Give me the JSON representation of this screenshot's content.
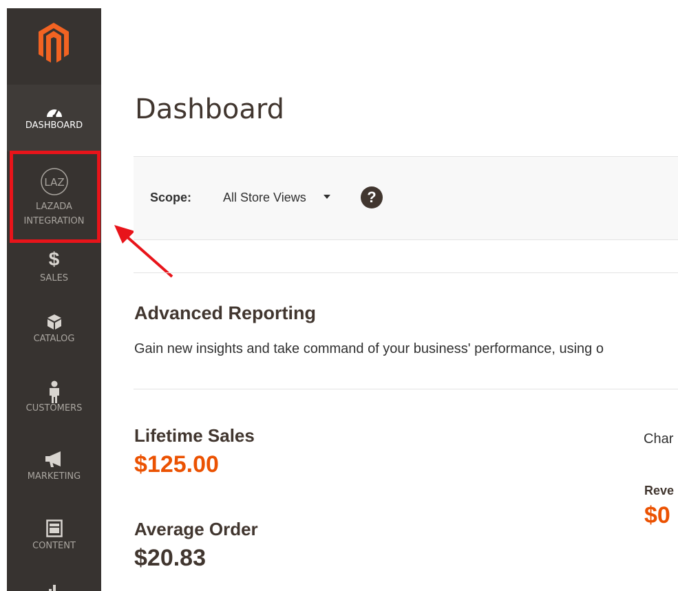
{
  "sidebar": {
    "logo": "magento-logo",
    "items": [
      {
        "label": "DASHBOARD",
        "icon": "dashboard-icon",
        "active": true
      },
      {
        "label": "LAZADA\nINTEGRATION",
        "line1": "LAZADA",
        "line2": "INTEGRATION",
        "icon": "laz-icon"
      },
      {
        "label": "SALES",
        "icon": "dollar-icon"
      },
      {
        "label": "CATALOG",
        "icon": "box-icon"
      },
      {
        "label": "CUSTOMERS",
        "icon": "person-icon"
      },
      {
        "label": "MARKETING",
        "icon": "megaphone-icon"
      },
      {
        "label": "CONTENT",
        "icon": "layout-icon"
      }
    ]
  },
  "header": {
    "title": "Dashboard"
  },
  "scope": {
    "label": "Scope:",
    "value": "All Store Views",
    "help": "?"
  },
  "advanced_reporting": {
    "title": "Advanced Reporting",
    "text": "Gain new insights and take command of your business' performance, using o"
  },
  "stats": {
    "lifetime_sales_label": "Lifetime Sales",
    "lifetime_sales_value": "$125.00",
    "average_order_label": "Average Order",
    "average_order_value": "$20.83"
  },
  "chart_panel": {
    "label": "Char",
    "revenue_label": "Reve",
    "revenue_value": "$0"
  },
  "annotation": {
    "highlight_color": "#e8141a"
  },
  "colors": {
    "sidebar_bg": "#373330",
    "accent_orange": "#eb5202",
    "text_dark": "#41362f"
  }
}
